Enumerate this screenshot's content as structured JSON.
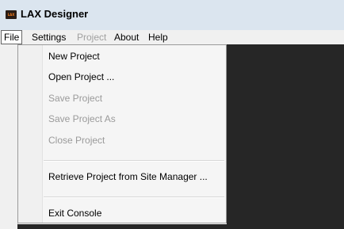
{
  "window": {
    "title": "LAX Designer",
    "logo_text": "LAX"
  },
  "menubar": {
    "file": "File",
    "settings": "Settings",
    "project": "Project",
    "about": "About",
    "help": "Help"
  },
  "file_menu": {
    "new_project": "New Project",
    "open_project": "Open Project ...",
    "save_project": "Save Project",
    "save_project_as": "Save Project As",
    "close_project": "Close Project",
    "retrieve_project": "Retrieve Project from Site Manager ...",
    "exit_console": "Exit Console"
  },
  "colors": {
    "titlebar": "#dbe5ef",
    "menubar": "#f0f0f0",
    "workspace": "#262626",
    "logo_accent": "#f07a1c"
  }
}
